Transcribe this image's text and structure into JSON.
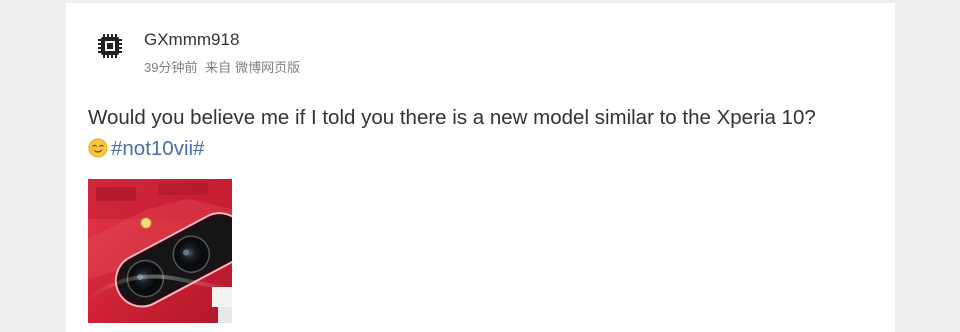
{
  "post": {
    "username": "GXmmm918",
    "time": "39分钟前",
    "source_prefix": "来自",
    "source": "微博网页版",
    "text": "Would you believe me if I told you there is a new model similar to the Xperia 10?",
    "hashtag": "#not10vii#",
    "avatar_icon": "chip-icon",
    "emoji_icon": "smirk-emoji-icon"
  },
  "colors": {
    "background": "#efefef",
    "card": "#ffffff",
    "text": "#333333",
    "meta": "#808080",
    "link": "#4a6ea8",
    "phone_red": "#d42a3c"
  }
}
